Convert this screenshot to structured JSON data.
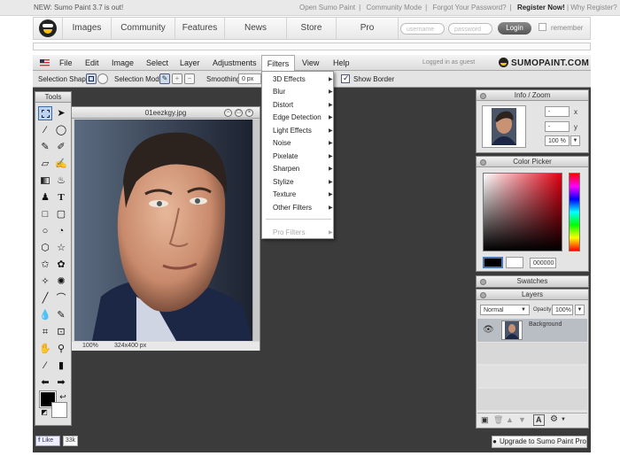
{
  "top_strip": {
    "news": "NEW: Sumo Paint 3.7 is out!",
    "links": [
      "Open Sumo Paint",
      "|",
      "Community Mode",
      "|",
      "Forgot Your Password?",
      "|"
    ],
    "register": "Register Now!",
    "why": "| Why Register?"
  },
  "nav": {
    "tabs": [
      "Images",
      "Community",
      "Features",
      "News",
      "Store",
      "Pro"
    ],
    "username_placeholder": "username",
    "password_placeholder": "password",
    "login": "Login",
    "remember": "remember"
  },
  "menubar": {
    "items": [
      "File",
      "Edit",
      "Image",
      "Select",
      "Layer",
      "Adjustments",
      "Filters",
      "View",
      "Help"
    ],
    "status": "Logged in as guest",
    "brand": "SUMOPAINT.COM"
  },
  "options": {
    "selection_shape": "Selection Shape:",
    "selection_mode": "Selection Mode:",
    "smoothing": "Smoothing:",
    "smoothing_value": "0 px",
    "show_border": "Show Border"
  },
  "filters_menu": {
    "items": [
      "3D Effects",
      "Blur",
      "Distort",
      "Edge Detection",
      "Light Effects",
      "Noise",
      "Pixelate",
      "Sharpen",
      "Stylize",
      "Texture",
      "Other Filters"
    ],
    "disabled_item": "Pro Filters"
  },
  "tools": {
    "title": "Tools"
  },
  "document": {
    "title": "01eezkgy.jpg",
    "zoom": "100%",
    "size": "324x400 px"
  },
  "info_zoom": {
    "title": "Info / Zoom",
    "x_label": "x",
    "y_label": "y",
    "x_value": "-",
    "y_value": "-",
    "zoom_value": "100 %"
  },
  "color_picker": {
    "title": "Color Picker",
    "hex": "000000"
  },
  "swatches": {
    "title": "Swatches"
  },
  "layers": {
    "title": "Layers",
    "blend_mode": "Normal",
    "opacity_label": "Opacity:",
    "opacity_value": "100%",
    "layer_name": "Background"
  },
  "footer": {
    "like": "Like",
    "like_count": "33k",
    "upgrade": "Upgrade to Sumo Paint Pro"
  },
  "colors": {
    "accent": "#3a6ea5",
    "workspace": "#3b3b3b",
    "foreground": "#000000",
    "background": "#ffffff"
  }
}
